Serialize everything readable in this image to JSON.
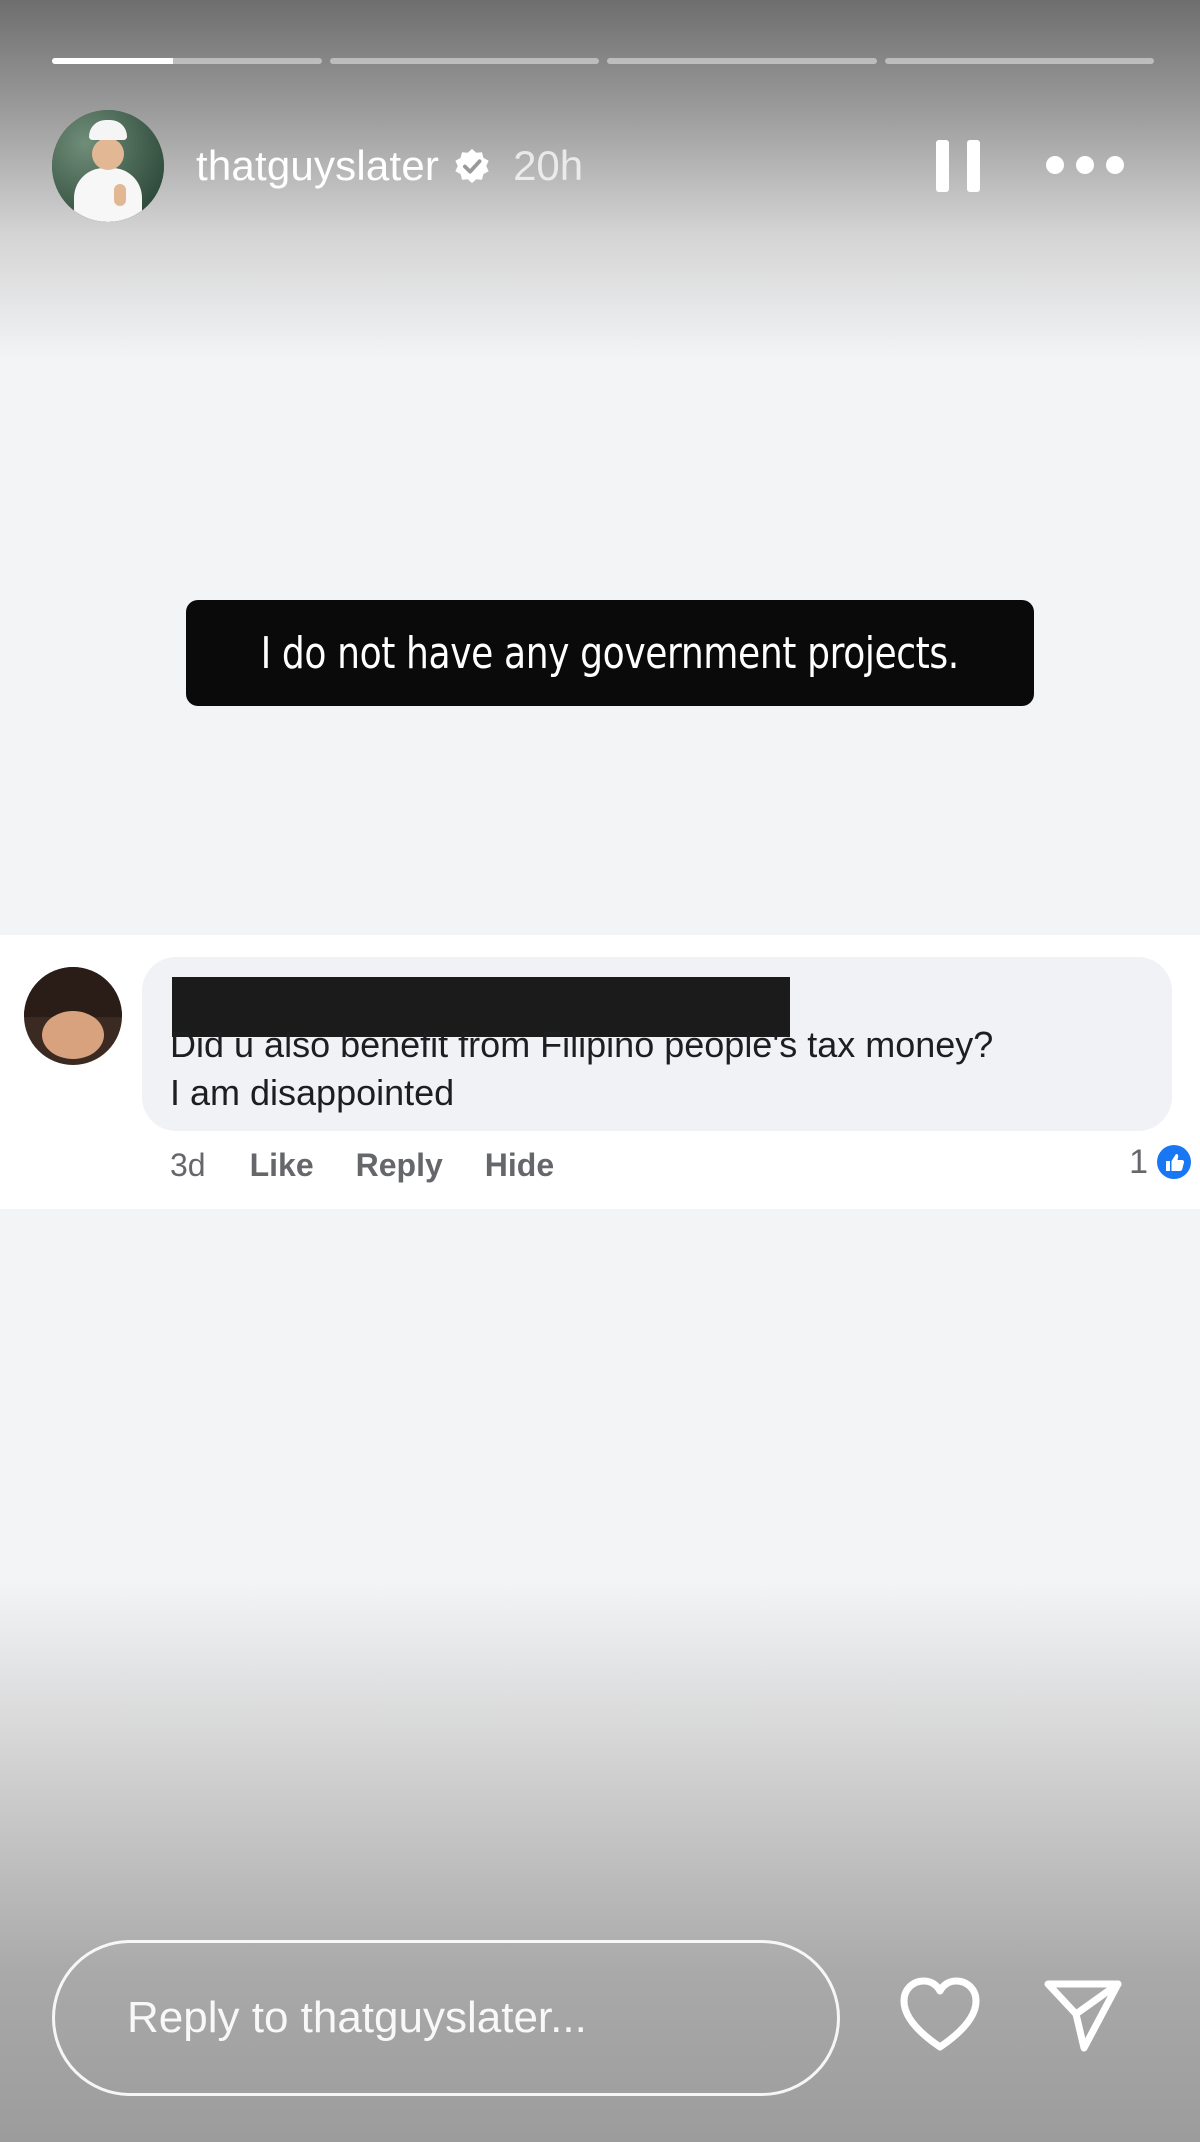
{
  "story": {
    "progress": {
      "segments": 4,
      "active_index": 0,
      "active_fraction": 0.45
    },
    "header": {
      "username": "thatguyslater",
      "verified": true,
      "timestamp": "20h",
      "avatar_icon": "profile-photo-avatar",
      "pause_icon": "pause-icon",
      "more_icon": "more-options-icon"
    },
    "caption": {
      "text": "I do not have any government projects."
    },
    "comment": {
      "text_line1": "Did u also benefit from Filipino people's tax money?",
      "text_line2": "I am disappointed",
      "age": "3d",
      "actions": [
        "Like",
        "Reply",
        "Hide"
      ],
      "reaction_count": "1",
      "reaction_icon": "like-thumb-icon",
      "reaction_color": "#1877f2",
      "author_redacted": true
    },
    "footer": {
      "reply_placeholder": "Reply to thatguyslater...",
      "like_icon": "heart-icon",
      "share_icon": "send-icon"
    }
  }
}
